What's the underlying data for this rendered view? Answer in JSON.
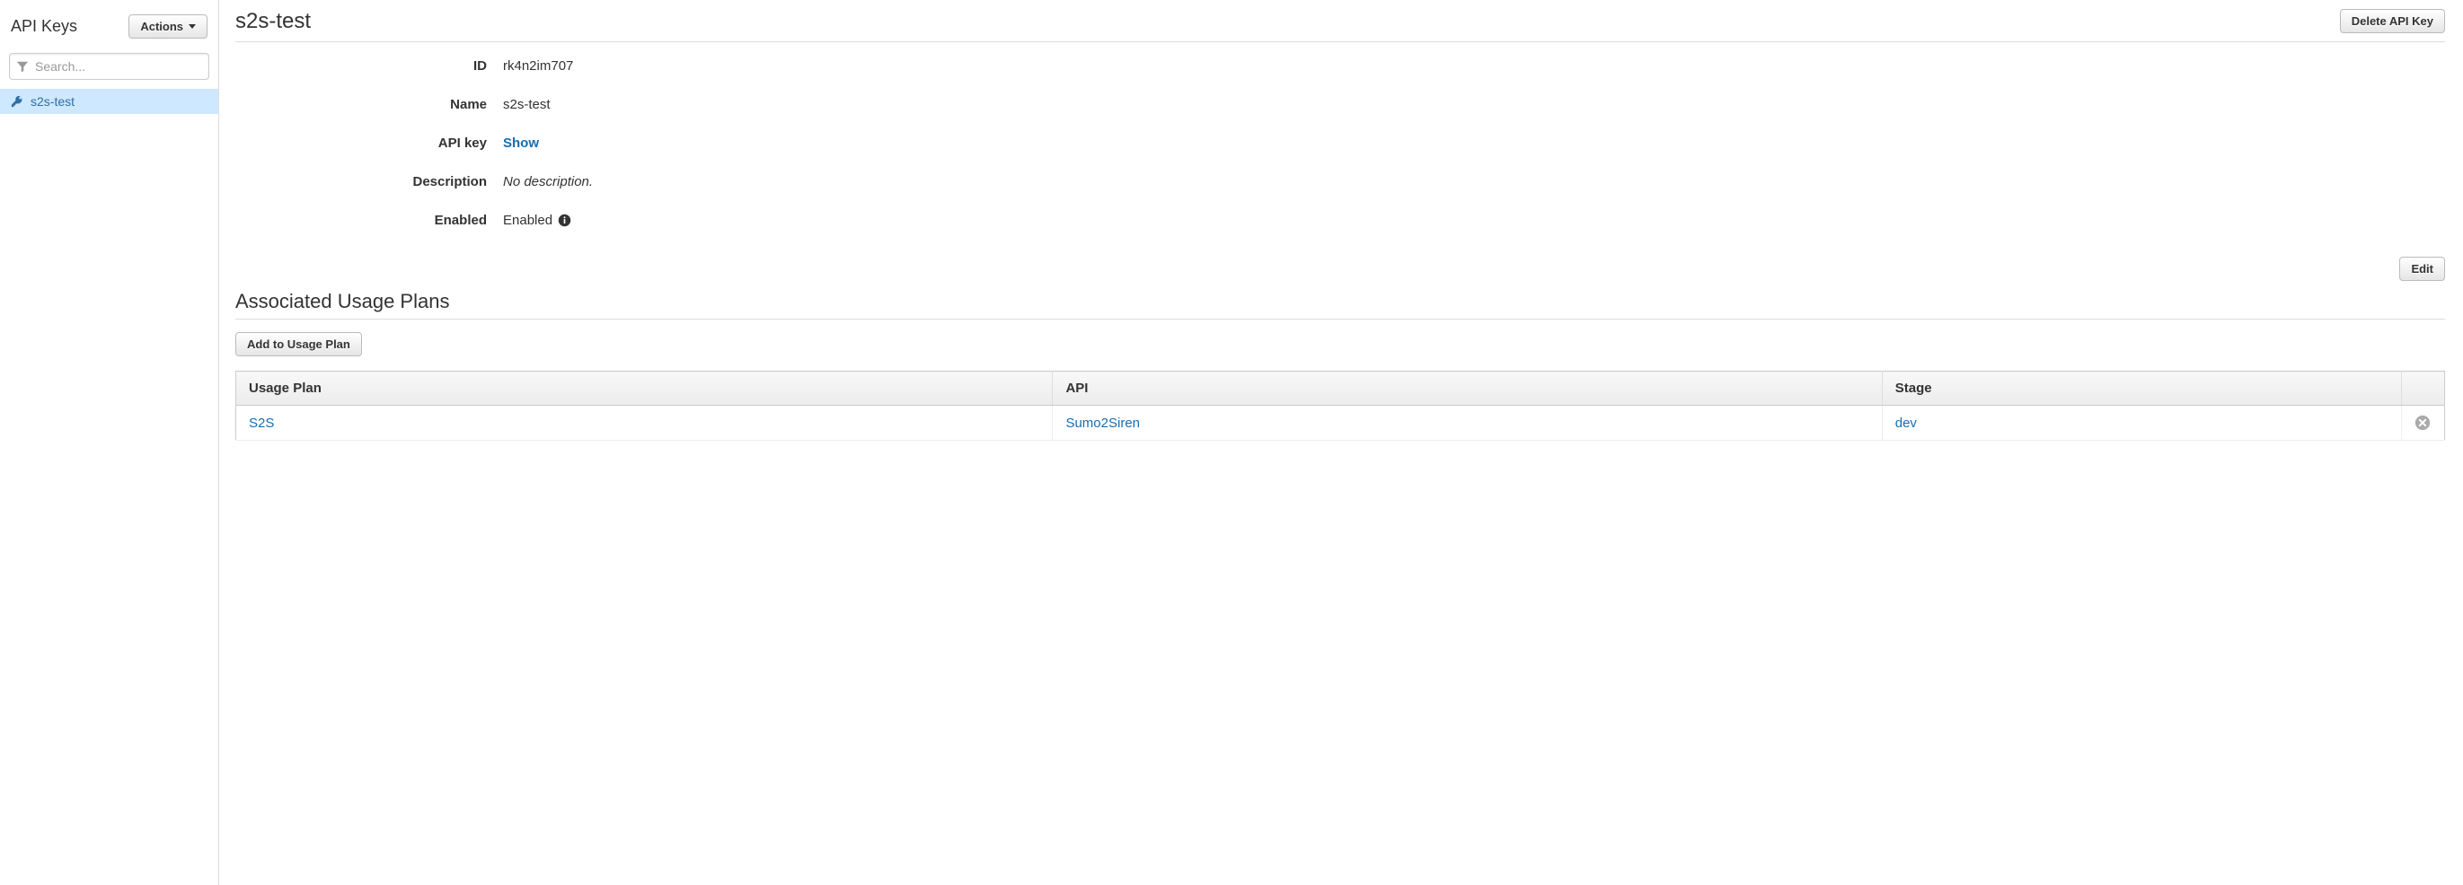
{
  "sidebar": {
    "title": "API Keys",
    "actions_label": "Actions",
    "search_placeholder": "Search...",
    "items": [
      {
        "label": "s2s-test"
      }
    ]
  },
  "header": {
    "title": "s2s-test",
    "delete_label": "Delete API Key"
  },
  "props": {
    "id_label": "ID",
    "id_value": "rk4n2im707",
    "name_label": "Name",
    "name_value": "s2s-test",
    "apikey_label": "API key",
    "apikey_show": "Show",
    "description_label": "Description",
    "description_value": "No description.",
    "enabled_label": "Enabled",
    "enabled_value": "Enabled"
  },
  "edit_label": "Edit",
  "usage": {
    "section_title": "Associated Usage Plans",
    "add_label": "Add to Usage Plan",
    "columns": {
      "plan": "Usage Plan",
      "api": "API",
      "stage": "Stage"
    },
    "rows": [
      {
        "plan": "S2S",
        "api": "Sumo2Siren",
        "stage": "dev"
      }
    ]
  }
}
